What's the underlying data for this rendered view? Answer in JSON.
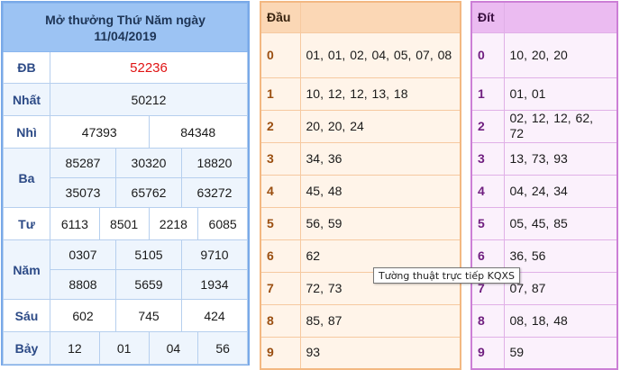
{
  "results": {
    "title_line1": "Mở thưởng Thứ Năm ngày",
    "title_line2": "11/04/2019",
    "prizes": {
      "db": {
        "label": "ĐB",
        "values": [
          "52236"
        ]
      },
      "nhat": {
        "label": "Nhất",
        "values": [
          "50212"
        ]
      },
      "nhi": {
        "label": "Nhì",
        "values": [
          "47393",
          "84348"
        ]
      },
      "ba": {
        "label": "Ba",
        "values": [
          "85287",
          "30320",
          "18820",
          "35073",
          "65762",
          "63272"
        ]
      },
      "tu": {
        "label": "Tư",
        "values": [
          "6113",
          "8501",
          "2218",
          "6085"
        ]
      },
      "nam": {
        "label": "Năm",
        "values": [
          "0307",
          "5105",
          "9710",
          "8808",
          "5659",
          "1934"
        ]
      },
      "sau": {
        "label": "Sáu",
        "values": [
          "602",
          "745",
          "424"
        ]
      },
      "bay": {
        "label": "Bảy",
        "values": [
          "12",
          "01",
          "04",
          "56"
        ]
      }
    }
  },
  "dau": {
    "header": "Đầu",
    "rows": [
      {
        "k": "0",
        "v": "01, 01, 02, 04, 05, 07, 08"
      },
      {
        "k": "1",
        "v": "10, 12, 12, 13, 18"
      },
      {
        "k": "2",
        "v": "20, 20, 24"
      },
      {
        "k": "3",
        "v": "34, 36"
      },
      {
        "k": "4",
        "v": "45, 48"
      },
      {
        "k": "5",
        "v": "56, 59"
      },
      {
        "k": "6",
        "v": "62"
      },
      {
        "k": "7",
        "v": "72, 73"
      },
      {
        "k": "8",
        "v": "85, 87"
      },
      {
        "k": "9",
        "v": "93"
      }
    ]
  },
  "dit": {
    "header": "Đít",
    "rows": [
      {
        "k": "0",
        "v": "10, 20, 20"
      },
      {
        "k": "1",
        "v": "01, 01"
      },
      {
        "k": "2",
        "v": "02, 12, 12, 62, 72"
      },
      {
        "k": "3",
        "v": "13, 73, 93"
      },
      {
        "k": "4",
        "v": "04, 24, 34"
      },
      {
        "k": "5",
        "v": "05, 45, 85"
      },
      {
        "k": "6",
        "v": "36, 56"
      },
      {
        "k": "7",
        "v": "07, 87"
      },
      {
        "k": "8",
        "v": "08, 18, 48"
      },
      {
        "k": "9",
        "v": "59"
      }
    ]
  },
  "tooltip": {
    "text": "Tường thuật trực tiếp KQXS"
  },
  "colors": {
    "results_header": "#9cc3f3",
    "special_prize": "#e01414",
    "dau_accent": "#f3b882",
    "dit_accent": "#cc7fd6"
  }
}
